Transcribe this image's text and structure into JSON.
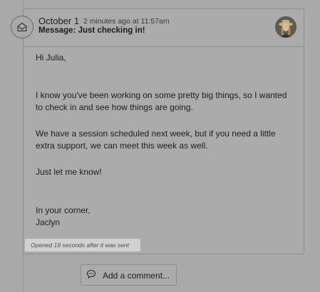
{
  "message": {
    "date": "October 1",
    "time_ago": "2 minutes ago at 11:57am",
    "subject": "Message: Just checking in!",
    "avatar_alt": "sender avatar",
    "body": {
      "greeting": "Hi Julia,",
      "paragraph1": "I know you've been working on some pretty big things, so I wanted to check in and see how things are going.",
      "paragraph2": "We have a session scheduled next week, but if you need a little extra support, we can meet this week as well.",
      "paragraph3": "Just let me know!",
      "signoff": "In your corner,",
      "signature": "Jaclyn"
    },
    "opened_status": "Opened 19 seconds after it was sent"
  },
  "comment": {
    "button_label": "Add a comment..."
  },
  "icons": {
    "mail": "mail-open-icon",
    "comment": "comment-icon"
  }
}
